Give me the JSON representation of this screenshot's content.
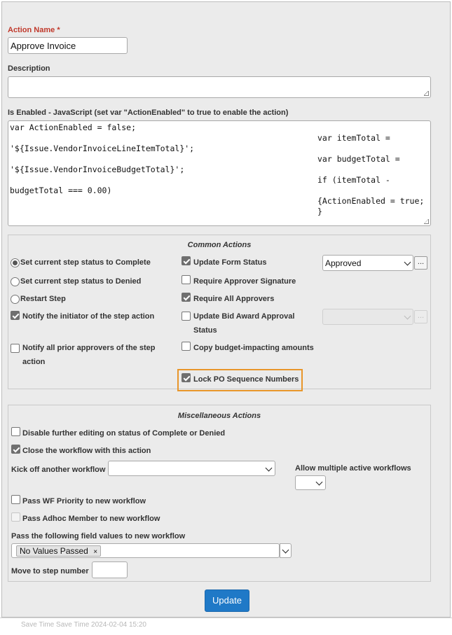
{
  "form": {
    "action_name": {
      "label": "Action Name",
      "required_mark": "*",
      "value": "Approve Invoice"
    },
    "description": {
      "label": "Description",
      "value": ""
    },
    "is_enabled": {
      "label": "Is Enabled - JavaScript (set var \"ActionEnabled\" to true to enable the action)",
      "left_lines": [
        "var ActionEnabled = false;",
        "'${Issue.VendorInvoiceLineItemTotal}';",
        "'${Issue.VendorInvoiceBudgetTotal}';",
        "budgetTotal === 0.00)"
      ],
      "right_lines": [
        "var itemTotal =",
        "var budgetTotal =",
        "if (itemTotal -",
        "{ActionEnabled = true;",
        "}"
      ]
    }
  },
  "common_actions": {
    "title": "Common Actions",
    "step_status": {
      "options": [
        {
          "label": "Set current step status to Complete",
          "selected": true
        },
        {
          "label": "Set current step status to Denied",
          "selected": false
        },
        {
          "label": "Restart Step",
          "selected": false
        }
      ]
    },
    "notify_initiator": {
      "label": "Notify the initiator of the step action",
      "checked": true
    },
    "notify_prior_approvers": {
      "line1": "Notify all prior approvers of the step",
      "line2": "action",
      "checked": false
    },
    "update_form_status": {
      "label": "Update Form Status",
      "checked": true,
      "select_value": "Approved",
      "browse_label": "..."
    },
    "require_approver_signature": {
      "label": "Require Approver Signature",
      "checked": false
    },
    "require_all_approvers": {
      "label": "Require All Approvers",
      "checked": true
    },
    "update_bid_award": {
      "line1": "Update Bid Award Approval",
      "line2": "Status",
      "checked": false,
      "select_value": "",
      "browse_label": "..."
    },
    "copy_budget": {
      "label": "Copy budget-impacting amounts",
      "checked": false
    },
    "lock_po_sequence": {
      "label": "Lock PO Sequence Numbers",
      "checked": true,
      "highlight_color": "#e8962a"
    }
  },
  "misc_actions": {
    "title": "Miscellaneous Actions",
    "disable_editing": {
      "label": "Disable further editing on status of Complete or Denied",
      "checked": false
    },
    "close_workflow": {
      "label": "Close the workflow with this action",
      "checked": true
    },
    "kickoff": {
      "label": "Kick off another workflow",
      "value": ""
    },
    "allow_multiple": {
      "label": "Allow multiple active workflows",
      "value": ""
    },
    "pass_priority": {
      "label": "Pass WF Priority to new workflow",
      "checked": false
    },
    "pass_adhoc": {
      "label": "Pass Adhoc Member to new workflow",
      "checked": false,
      "disabled": true
    },
    "pass_fields": {
      "label": "Pass the following field values to new workflow",
      "tag": "No Values Passed",
      "tag_remove": "×"
    },
    "move_to_step": {
      "label": "Move to step number",
      "value": ""
    }
  },
  "buttons": {
    "update": "Update",
    "update_color": "#1f79c7"
  },
  "footer_partial_text": "Save Time    Save Time  2024-02-04 15:20"
}
